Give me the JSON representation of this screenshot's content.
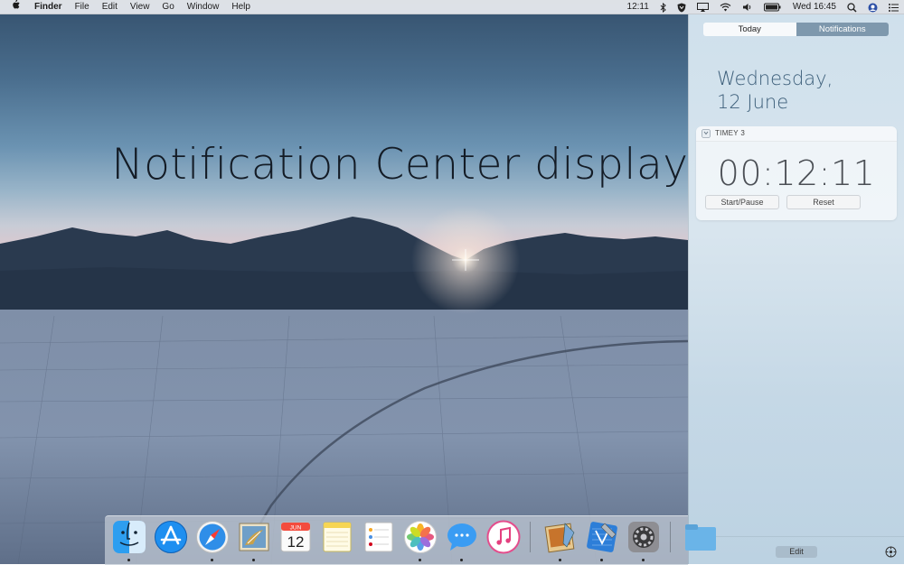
{
  "menubar": {
    "apple_icon": "apple-logo",
    "app_name": "Finder",
    "menus": [
      "File",
      "Edit",
      "View",
      "Go",
      "Window",
      "Help"
    ],
    "timer_text": "12:11",
    "clock": "Wed 16:45",
    "status_icons": [
      "bluetooth-icon",
      "shield-icon",
      "airplay-icon",
      "wifi-icon",
      "volume-icon",
      "battery-icon",
      "spotlight-icon",
      "user-avatar-icon",
      "notification-center-icon"
    ]
  },
  "overlay_text": "Notification Center display",
  "notification_center": {
    "tabs": [
      "Today",
      "Notifications"
    ],
    "active_tab": "Today",
    "date_line1": "Wednesday,",
    "date_line2": "12 June",
    "widget": {
      "name": "TIMEY 3",
      "time": "00:12:11",
      "start_pause": "Start/Pause",
      "reset": "Reset"
    },
    "edit_label": "Edit"
  },
  "dock": {
    "apps": [
      {
        "name": "Finder",
        "icon": "finder-icon",
        "running": true
      },
      {
        "name": "App Store",
        "icon": "app-store-icon",
        "running": false
      },
      {
        "name": "Safari",
        "icon": "safari-icon",
        "running": true
      },
      {
        "name": "Mail",
        "icon": "mail-icon",
        "running": true
      },
      {
        "name": "Calendar",
        "icon": "calendar-icon",
        "running": false,
        "month": "JUN",
        "day": "12"
      },
      {
        "name": "Notes",
        "icon": "notes-icon",
        "running": false
      },
      {
        "name": "Reminders",
        "icon": "reminders-icon",
        "running": false
      },
      {
        "name": "Photos",
        "icon": "photos-icon",
        "running": true
      },
      {
        "name": "Messages",
        "icon": "messages-icon",
        "running": true
      },
      {
        "name": "iTunes",
        "icon": "itunes-icon",
        "running": false
      },
      {
        "name": "Preview",
        "icon": "preview-icon",
        "running": true
      },
      {
        "name": "Xcode",
        "icon": "xcode-icon",
        "running": true
      },
      {
        "name": "System Preferences",
        "icon": "system-preferences-icon",
        "running": true
      },
      {
        "name": "Downloads",
        "icon": "folder-icon",
        "running": false
      }
    ]
  }
}
